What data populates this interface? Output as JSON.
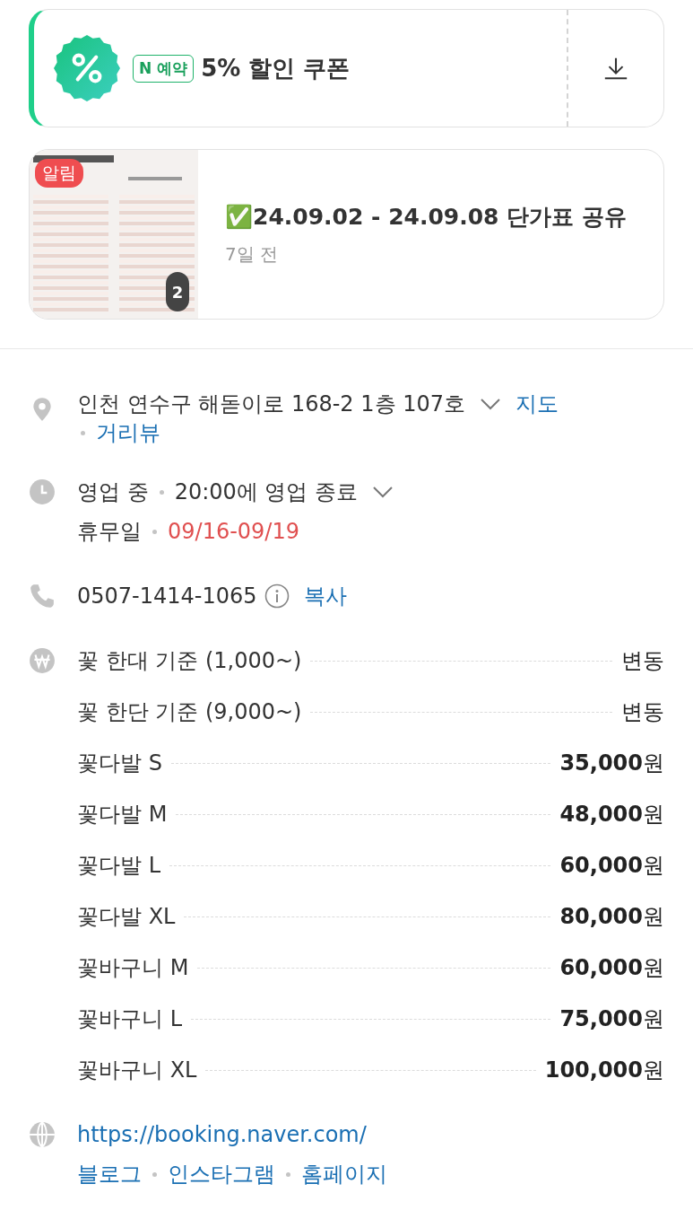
{
  "coupon": {
    "tag": "N 예약",
    "title": "5% 할인 쿠폰"
  },
  "notice": {
    "badge": "알림",
    "count": "2",
    "title": "✅24.09.02 - 24.09.08 단가표 공유",
    "time": "7일 전"
  },
  "address": {
    "text": "인천 연수구 해돋이로 168-2 1층 107호",
    "links": [
      "지도",
      "거리뷰"
    ]
  },
  "hours": {
    "status": "영업 중",
    "close": "20:00에 영업 종료",
    "holiday_label": "휴무일",
    "holiday": "09/16-09/19"
  },
  "phone": {
    "number": "0507-1414-1065",
    "copy": "복사"
  },
  "prices": [
    {
      "name": "꽃 한대 기준 (1,000~)",
      "price": "변동"
    },
    {
      "name": "꽃 한단 기준 (9,000~)",
      "price": "변동"
    },
    {
      "name": "꽃다발 S",
      "price": "**35,000**원"
    },
    {
      "name": "꽃다발 M",
      "price": "**48,000**원"
    },
    {
      "name": "꽃다발 L",
      "price": "**60,000**원"
    },
    {
      "name": "꽃다발 XL",
      "price": "**80,000**원"
    },
    {
      "name": "꽃바구니 M",
      "price": "**60,000**원"
    },
    {
      "name": "꽃바구니 L",
      "price": "**75,000**원"
    },
    {
      "name": "꽃바구니 XL",
      "price": "**100,000**원"
    }
  ],
  "website": {
    "url": "https://booking.naver.com/",
    "links": [
      "블로그",
      "인스타그램",
      "홈페이지"
    ]
  }
}
